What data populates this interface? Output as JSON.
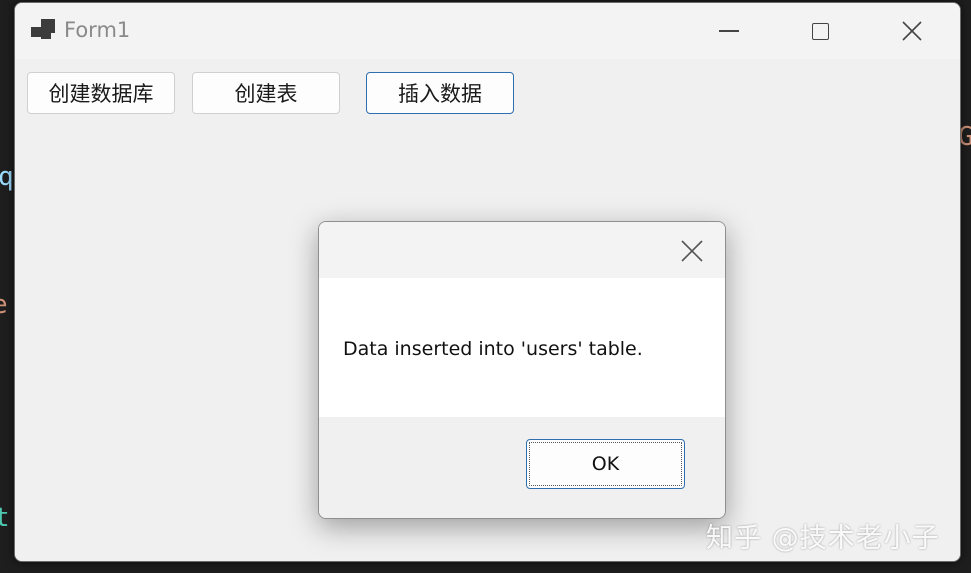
{
  "window": {
    "title": "Form1",
    "icon": "app-window-icon",
    "controls": {
      "minimize_icon": "minimize-icon",
      "maximize_icon": "maximize-icon",
      "close_icon": "close-icon"
    }
  },
  "toolbar": {
    "create_database_label": "创建数据库",
    "create_table_label": "创建表",
    "insert_data_label": "插入数据"
  },
  "dialog": {
    "message": "Data inserted into 'users' table.",
    "ok_label": "OK",
    "close_icon": "close-icon"
  },
  "background": {
    "fragment_g": "G",
    "fragment_q": "q",
    "fragment_e": "e",
    "fragment_t": "t."
  },
  "watermark": {
    "text": "知乎 @技术老小子"
  },
  "colors": {
    "accent_border": "#2f6fb0",
    "window_bg": "#f0f0f0",
    "editor_bg": "#1e1e1e"
  }
}
